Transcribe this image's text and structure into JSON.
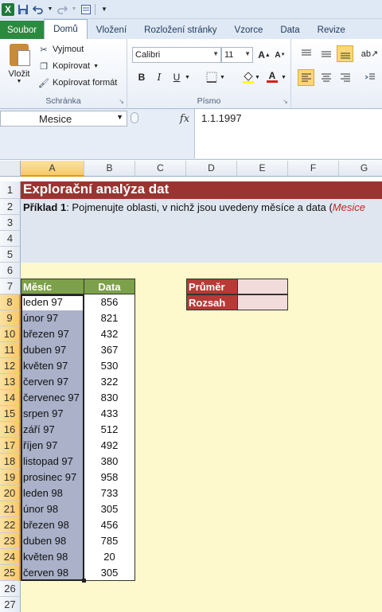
{
  "qat": {
    "app_icon": "X",
    "save_icon": "save-icon",
    "undo_icon": "undo-icon",
    "redo_icon": "redo-icon",
    "more_icon": "customize-icon"
  },
  "tabs": [
    "Soubor",
    "Domů",
    "Vložení",
    "Rozložení stránky",
    "Vzorce",
    "Data",
    "Revize"
  ],
  "clipboard": {
    "paste": "Vložit",
    "cut": "Vyjmout",
    "copy": "Kopírovat",
    "format_painter": "Kopírovat formát",
    "group_label": "Schránka"
  },
  "font": {
    "name": "Calibri",
    "size": "11",
    "group_label": "Písmo",
    "bold": "B",
    "italic": "I",
    "underline": "U"
  },
  "formula_bar": {
    "name_box": "Mesice",
    "fx": "fx",
    "value": "1.1.1997"
  },
  "columns": [
    "A",
    "B",
    "C",
    "D",
    "E",
    "F",
    "G"
  ],
  "rows": [
    "1",
    "2",
    "3",
    "4",
    "5",
    "6",
    "7",
    "8",
    "9",
    "10",
    "11",
    "12",
    "13",
    "14",
    "15",
    "16",
    "17",
    "18",
    "19",
    "20",
    "21",
    "22",
    "23",
    "24",
    "25",
    "26",
    "27"
  ],
  "sheet": {
    "title": "Explorační analýza dat",
    "desc_bold": "Příklad 1",
    "desc_rest": ": Pojmenujte oblasti, v nichž jsou uvedeny měsíce a data (",
    "desc_italic": "Mesice",
    "header_month": "Měsíc",
    "header_data": "Data",
    "stats": [
      "Průměr",
      "Rozsah"
    ],
    "months": [
      "leden 97",
      "únor 97",
      "březen 97",
      "duben 97",
      "květen 97",
      "červen 97",
      "červenec 97",
      "srpen 97",
      "září 97",
      "říjen 97",
      "listopad 97",
      "prosinec 97",
      "leden 98",
      "únor 98",
      "březen 98",
      "duben 98",
      "květen 98",
      "červen 98"
    ],
    "values": [
      "856",
      "821",
      "432",
      "367",
      "530",
      "322",
      "830",
      "433",
      "512",
      "492",
      "380",
      "958",
      "733",
      "305",
      "456",
      "785",
      "20",
      "305"
    ]
  },
  "colors": {
    "title_bg": "#9b3431",
    "header_bg": "#7da14b",
    "month_bg": "#aab1c9",
    "sheet_bg": "#fdf9cc",
    "stat_bg": "#b63a36"
  }
}
